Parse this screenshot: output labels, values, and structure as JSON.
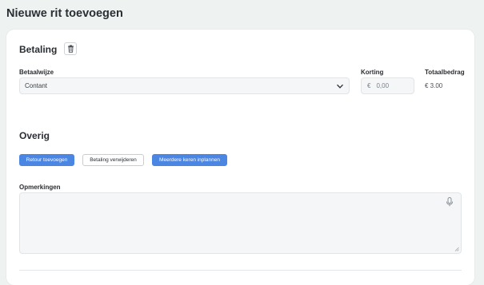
{
  "page": {
    "title": "Nieuwe rit toevoegen"
  },
  "payment": {
    "title": "Betaling",
    "method_label": "Betaalwijze",
    "method_value": "Contant",
    "discount_label": "Korting",
    "discount_currency": "€",
    "discount_placeholder": "0,00",
    "total_label": "Totaalbedrag",
    "total_value": "€ 3.00"
  },
  "other": {
    "title": "Overig",
    "buttons": {
      "add_return": "Retour toevoegen",
      "remove_payment": "Betaling verwijderen",
      "schedule_multiple": "Meerdere keren inplannen"
    },
    "remarks_label": "Opmerkingen"
  },
  "colors": {
    "primary": "#4b86e3",
    "background": "#eef3f2"
  },
  "icons": [
    "trash-icon",
    "chevron-down-icon",
    "microphone-icon",
    "resize-grip-icon"
  ]
}
